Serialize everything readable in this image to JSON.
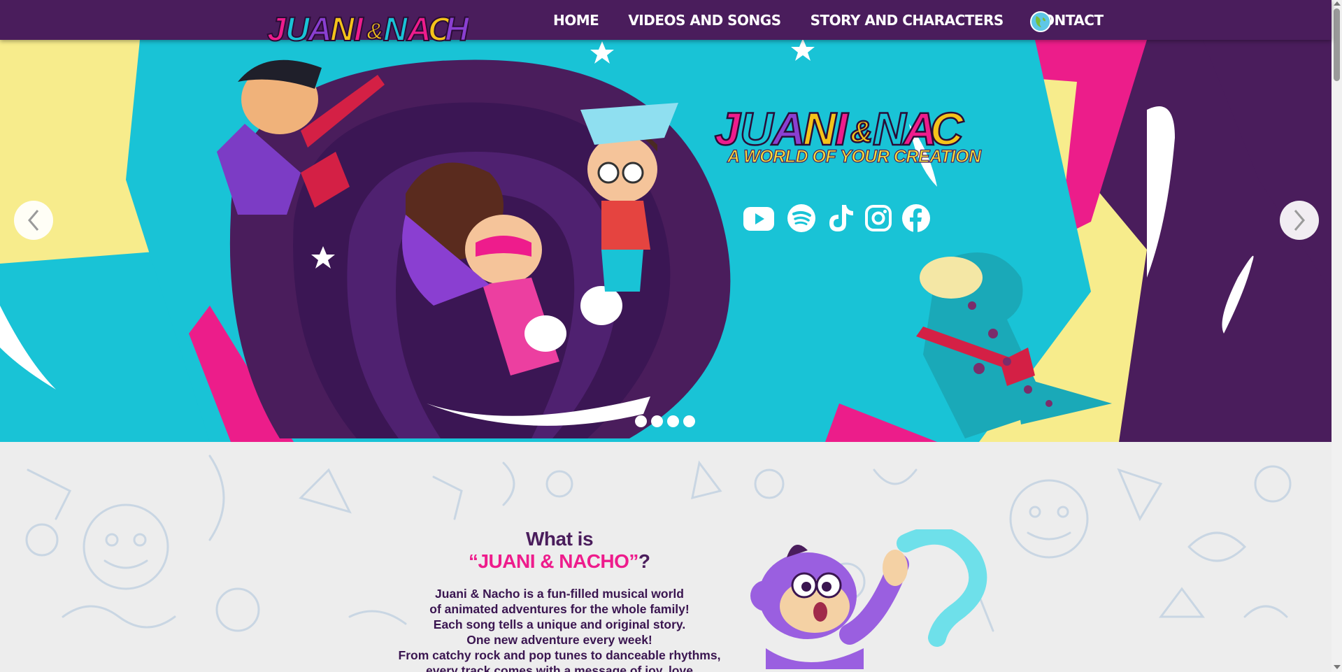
{
  "header": {
    "logo_text": "JUANI & NACHO",
    "nav": [
      "HOME",
      "VIDEOS AND SONGS",
      "STORY AND CHARACTERS",
      "CONTACT"
    ],
    "language_icon": "globe-icon"
  },
  "hero": {
    "logo_text": "JUANI & NACHO",
    "tagline": "A WORLD OF YOUR CREATION",
    "social_icons": [
      "youtube-icon",
      "spotify-icon",
      "tiktok-icon",
      "instagram-icon",
      "facebook-icon"
    ],
    "slide_count": 4
  },
  "about": {
    "title_line1": "What is",
    "title_highlight": "“JUANI & NACHO”",
    "title_suffix": "?",
    "description": [
      "Juani & Nacho is a fun-filled musical world",
      "of animated adventures for the whole family!",
      "Each song tells a unique and original story.",
      "One new adventure every week!",
      "From catchy rock and pop tunes to danceable rhythms,",
      "every track comes with a message of joy, love"
    ]
  },
  "colors": {
    "header_bg": "#4a1d5c",
    "brand_pink": "#ee1c8c",
    "brand_purple": "#4a1d5c",
    "hero_cyan": "#19c3d6",
    "hero_yellow": "#f7ec8c",
    "hero_magenta": "#ec1d8a",
    "section_bg": "#ededed"
  }
}
